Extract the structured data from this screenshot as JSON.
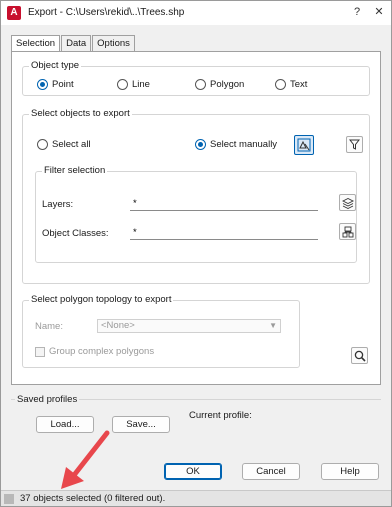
{
  "window": {
    "title": "Export - C:\\Users\\rekid\\..\\Trees.shp",
    "app_icon_letter": "A"
  },
  "title_bar": {
    "help": "?",
    "close": "✕"
  },
  "tabs": [
    {
      "label": "Selection"
    },
    {
      "label": "Data"
    },
    {
      "label": "Options"
    }
  ],
  "object_type": {
    "title": "Object type",
    "options": [
      {
        "label": "Point",
        "selected": true
      },
      {
        "label": "Line",
        "selected": false
      },
      {
        "label": "Polygon",
        "selected": false
      },
      {
        "label": "Text",
        "selected": false
      }
    ]
  },
  "select_objects": {
    "title": "Select objects to export",
    "select_all": "Select all",
    "select_manually": "Select manually",
    "filter": {
      "title": "Filter selection",
      "layers_label": "Layers:",
      "layers_value": "*",
      "object_classes_label": "Object Classes:",
      "object_classes_value": "*"
    }
  },
  "topology": {
    "title": "Select polygon topology to export",
    "name_label": "Name:",
    "name_value": "<None>",
    "group_label": "Group complex polygons"
  },
  "profiles": {
    "title": "Saved profiles",
    "load": "Load...",
    "save": "Save...",
    "current_profile_label": "Current profile:"
  },
  "dialog_buttons": {
    "ok": "OK",
    "cancel": "Cancel",
    "help": "Help"
  },
  "status": {
    "text": "37 objects selected (0 filtered out)."
  },
  "colors": {
    "accent": "#0063b1",
    "arrow": "#e8474c",
    "app_icon": "#c8102e"
  },
  "icons": [
    "select-objects-icon",
    "quick-select-filter-icon",
    "layers-icon",
    "object-classes-icon",
    "zoom-magnifier-icon"
  ]
}
